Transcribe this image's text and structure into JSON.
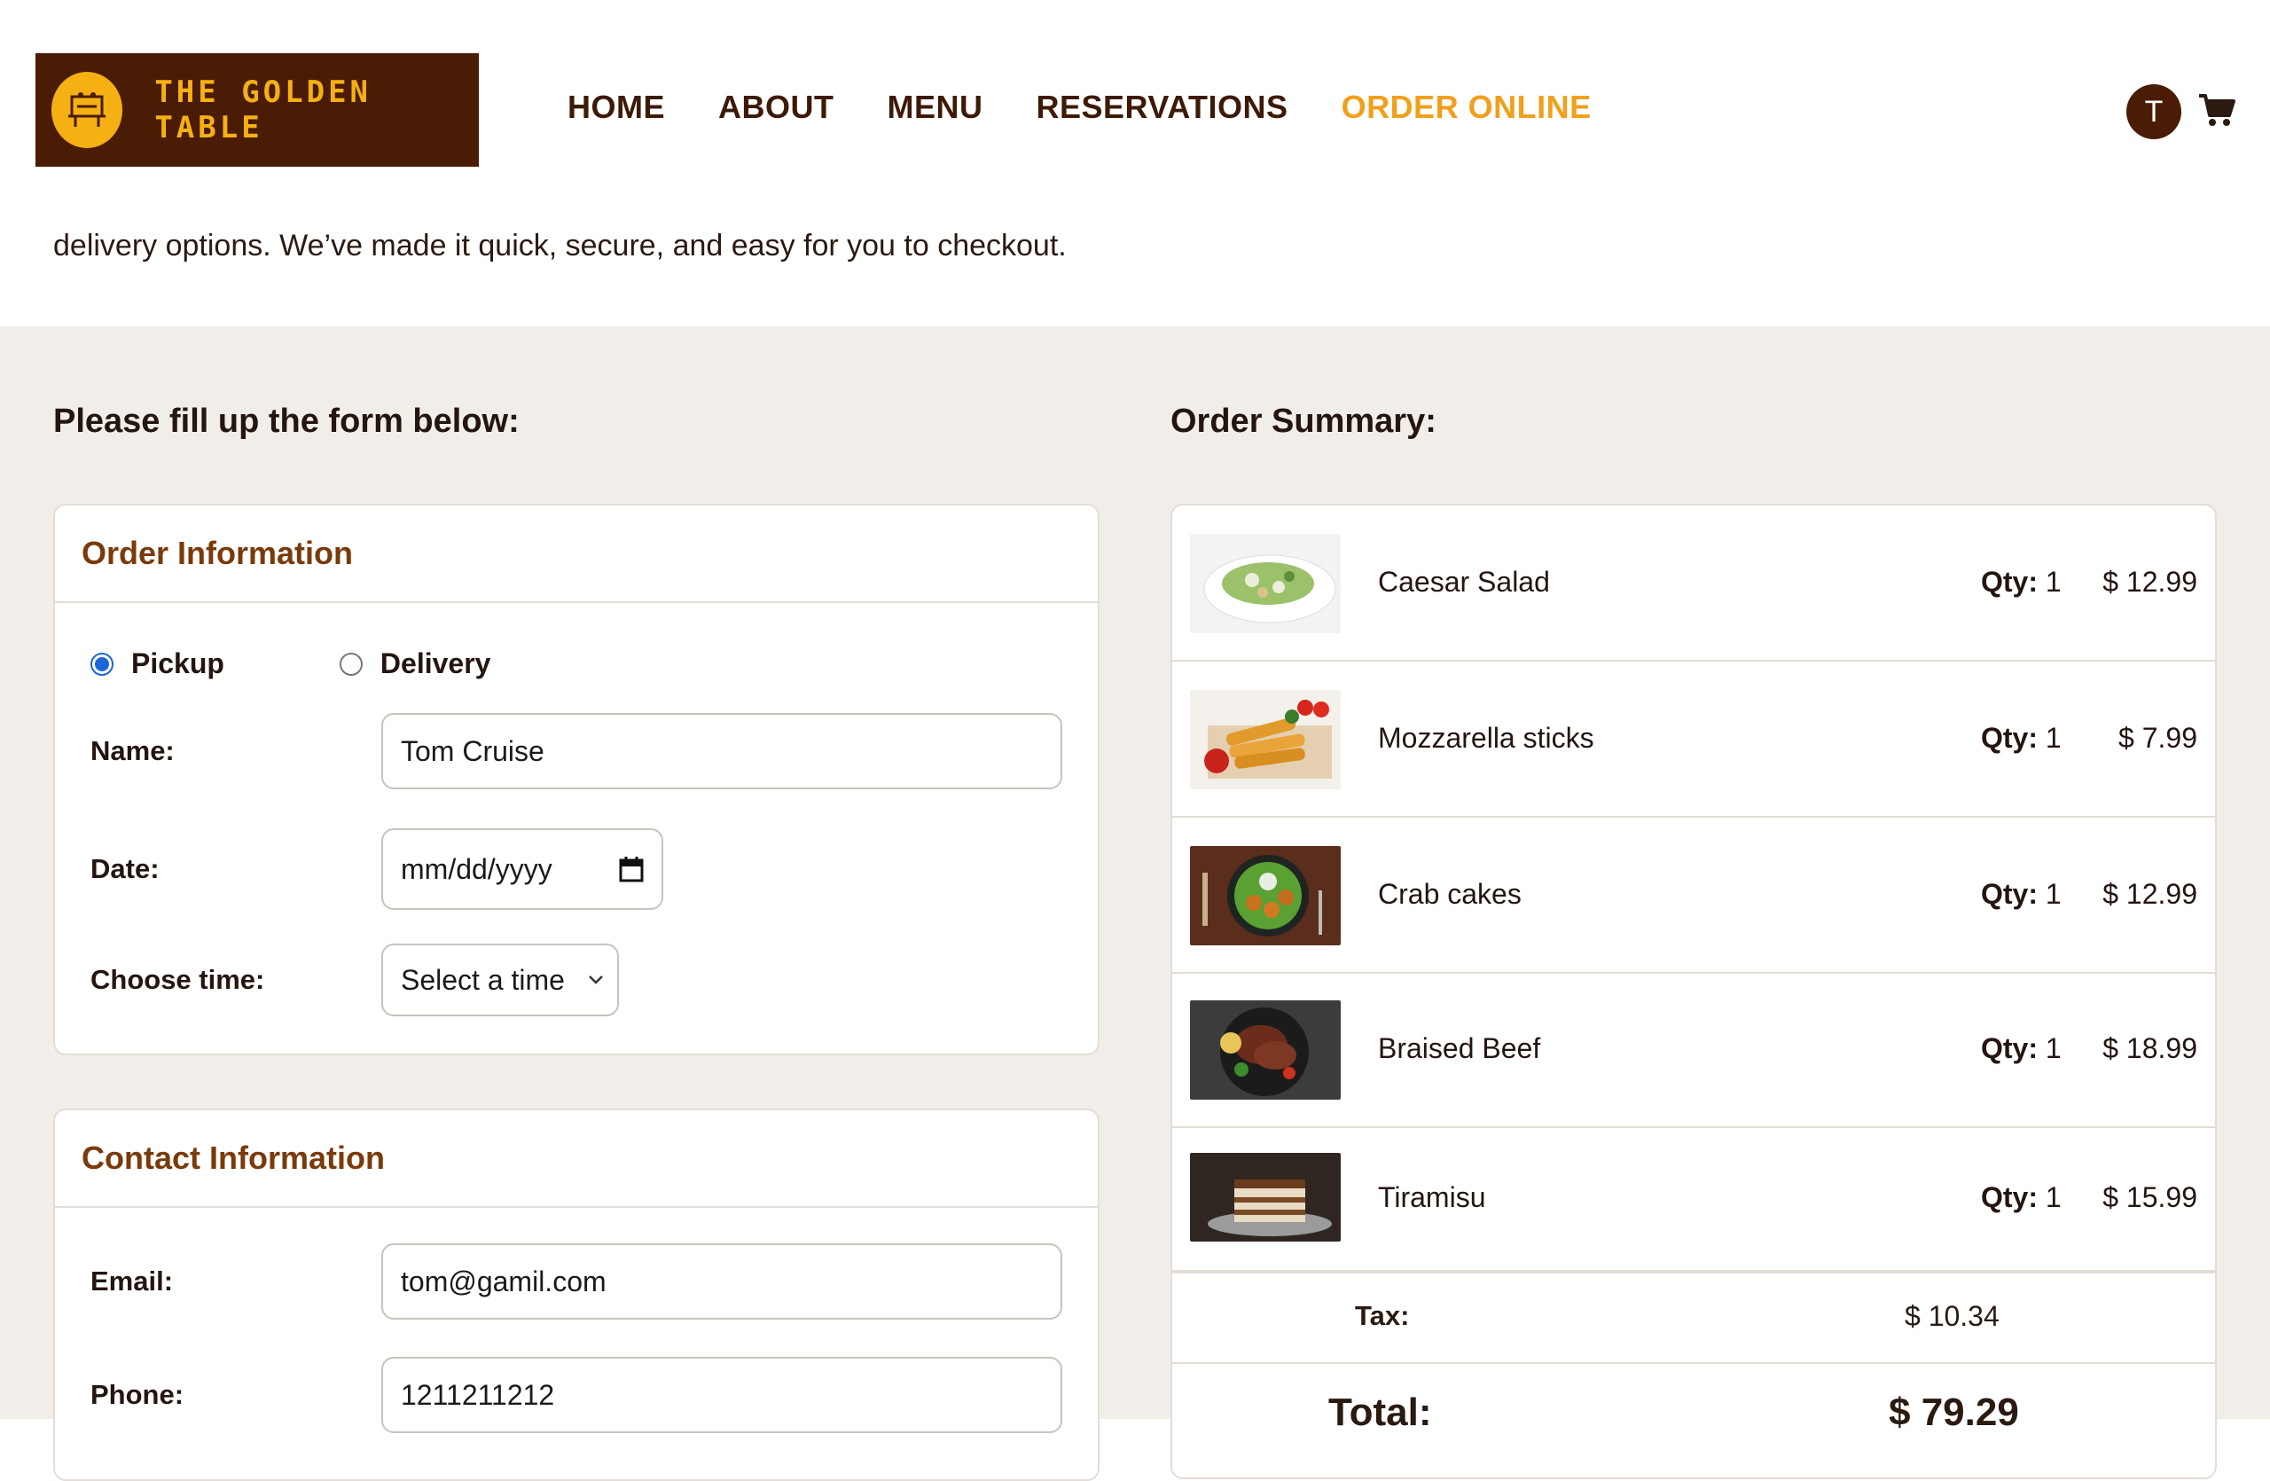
{
  "brand": {
    "name": "THE GOLDEN TABLE",
    "color": "#4a1c05",
    "accent": "#f5b014"
  },
  "nav": {
    "items": [
      {
        "label": "HOME"
      },
      {
        "label": "ABOUT"
      },
      {
        "label": "MENU"
      },
      {
        "label": "RESERVATIONS"
      },
      {
        "label": "ORDER ONLINE",
        "active": true
      }
    ],
    "avatar_initial": "T",
    "cart_icon": "cart-icon",
    "active_color": "#f0a01c"
  },
  "intro": {
    "text": "delivery options. We’ve made it quick, secure, and easy for you to checkout."
  },
  "form": {
    "heading": "Please fill up the form below:",
    "order_info": {
      "title": "Order Information",
      "pickup_label": "Pickup",
      "delivery_label": "Delivery",
      "selected": "Pickup",
      "name_label": "Name:",
      "name_value": "Tom Cruise",
      "date_label": "Date:",
      "date_placeholder": "mm/dd/yyyy",
      "time_label": "Choose time:",
      "time_value": "Select a time"
    },
    "contact_info": {
      "title": "Contact Information",
      "email_label": "Email:",
      "email_value": "tom@gamil.com",
      "phone_label": "Phone:",
      "phone_value": "1211211212"
    }
  },
  "summary": {
    "heading": "Order Summary:",
    "qty_label": "Qty:",
    "items": [
      {
        "name": "Caesar Salad",
        "qty": "1",
        "price": "$ 12.99"
      },
      {
        "name": "Mozzarella sticks",
        "qty": "1",
        "price": "$ 7.99"
      },
      {
        "name": "Crab cakes",
        "qty": "1",
        "price": "$ 12.99"
      },
      {
        "name": "Braised Beef",
        "qty": "1",
        "price": "$ 18.99"
      },
      {
        "name": "Tiramisu",
        "qty": "1",
        "price": "$ 15.99"
      }
    ],
    "tax_label": "Tax:",
    "tax_value": "$ 10.34",
    "total_label": "Total:",
    "total_value": "$ 79.29"
  }
}
